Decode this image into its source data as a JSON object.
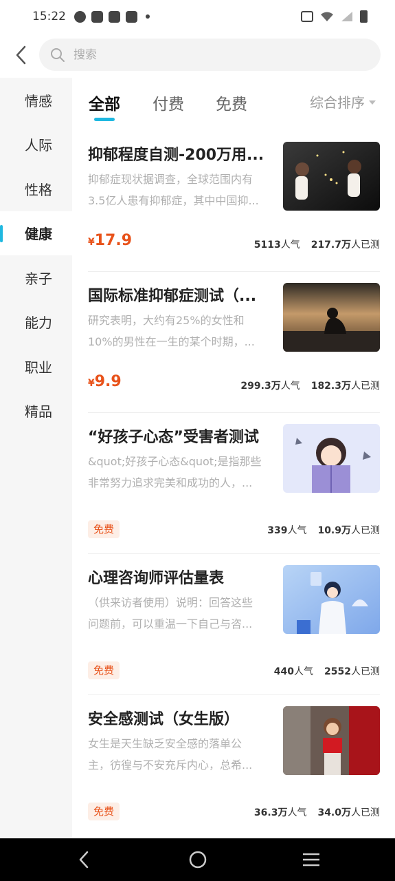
{
  "status_bar": {
    "time": "15:22"
  },
  "search": {
    "placeholder": "搜索"
  },
  "sidebar": {
    "items": [
      {
        "label": "情感"
      },
      {
        "label": "人际"
      },
      {
        "label": "性格"
      },
      {
        "label": "健康",
        "active": true
      },
      {
        "label": "亲子"
      },
      {
        "label": "能力"
      },
      {
        "label": "职业"
      },
      {
        "label": "精品"
      }
    ]
  },
  "tabs": {
    "items": [
      {
        "label": "全部",
        "active": true
      },
      {
        "label": "付费"
      },
      {
        "label": "免费"
      }
    ],
    "sort_label": "综合排序"
  },
  "list": {
    "items": [
      {
        "title": "抑郁程度自测-200万用...",
        "desc_line1": "抑郁症现状据调查，全球范围内有",
        "desc_line2": "3.5亿人患有抑郁症，其中中国抑...",
        "price_symbol": "¥",
        "price": "17.9",
        "popularity": "5113",
        "popularity_unit": "人气",
        "tested": "217.7万",
        "tested_unit": "人已测",
        "thumb_icon": "two-girls-illustration"
      },
      {
        "title": "国际标准抑郁症测试（...",
        "desc_line1": "研究表明，大约有25%的女性和",
        "desc_line2": "10%的男性在一生的某个时期，...",
        "price_symbol": "¥",
        "price": "9.9",
        "popularity": "299.3万",
        "popularity_unit": "人气",
        "tested": "182.3万",
        "tested_unit": "人已测",
        "thumb_icon": "sad-person-photo"
      },
      {
        "title": "“好孩子心态”受害者测试",
        "desc_line1": "&quot;好孩子心态&quot;是指那些",
        "desc_line2": "非常努力追求完美和成功的人，...",
        "free_label": "免费",
        "popularity": "339",
        "popularity_unit": "人气",
        "tested": "10.9万",
        "tested_unit": "人已测",
        "thumb_icon": "girl-reading-illustration"
      },
      {
        "title": "心理咨询师评估量表",
        "desc_line1": "（供来访者使用）说明：回答这些",
        "desc_line2": "问题前，可以重温一下自己与咨...",
        "free_label": "免费",
        "popularity": "440",
        "popularity_unit": "人气",
        "tested": "2552",
        "tested_unit": "人已测",
        "thumb_icon": "doctor-illustration"
      },
      {
        "title": "安全感测试（女生版）",
        "desc_line1": "女生是天生缺乏安全感的落单公",
        "desc_line2": "主，彷徨与不安充斥内心，总希...",
        "free_label": "免费",
        "popularity": "36.3万",
        "popularity_unit": "人气",
        "tested": "34.0万",
        "tested_unit": "人已测",
        "thumb_icon": "woman-photo"
      }
    ]
  },
  "colors": {
    "accent": "#1fb8e0",
    "price": "#e8521a",
    "free_bg": "#fdeee6"
  }
}
